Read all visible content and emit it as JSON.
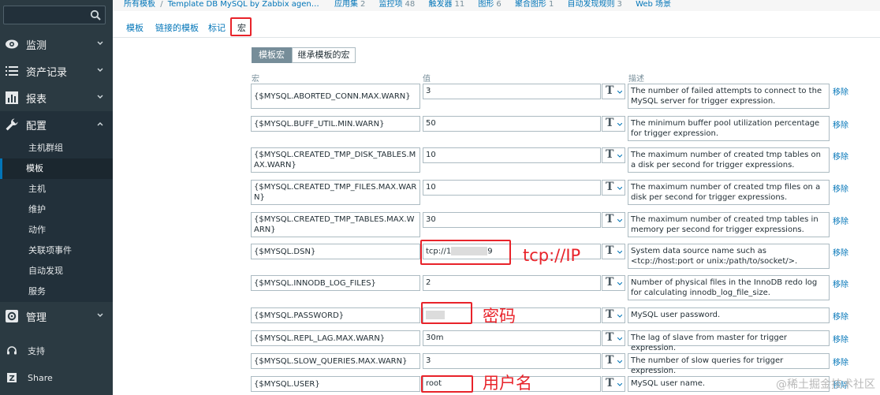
{
  "sidebar": {
    "sections": [
      {
        "label": "监测",
        "icon": "eye-icon"
      },
      {
        "label": "资产记录",
        "icon": "list-icon"
      },
      {
        "label": "报表",
        "icon": "bar-chart-icon"
      },
      {
        "label": "配置",
        "icon": "wrench-icon"
      },
      {
        "label": "管理",
        "icon": "gear-icon"
      }
    ],
    "config_items": [
      "主机群组",
      "模板",
      "主机",
      "维护",
      "动作",
      "关联项事件",
      "自动发现",
      "服务"
    ],
    "bottom": [
      {
        "label": "支持",
        "icon": "headset-icon"
      },
      {
        "label": "Share",
        "icon": "share-icon"
      }
    ]
  },
  "header": {
    "crumb_root": "所有模板",
    "crumb_template": "Template DB MySQL by Zabbix agen…",
    "links": [
      {
        "label": "应用集",
        "count": "2"
      },
      {
        "label": "监控项",
        "count": "48"
      },
      {
        "label": "触发器",
        "count": "11"
      },
      {
        "label": "图形",
        "count": "6"
      },
      {
        "label": "聚合图形",
        "count": "1"
      },
      {
        "label": "自动发现规则",
        "count": "3"
      },
      {
        "label": "Web 场景",
        "count": ""
      }
    ]
  },
  "tabs": [
    "模板",
    "链接的模板",
    "标记",
    "宏"
  ],
  "segment": {
    "template_macros": "模板宏",
    "inherited_macros": "继承模板的宏"
  },
  "columns": {
    "macro": "宏",
    "value": "值",
    "description": "描述"
  },
  "remove_label": "移除",
  "macros": [
    {
      "macro": "{$MYSQL.ABORTED_CONN.MAX.WARN}",
      "value": "3",
      "description": "The number of failed attempts to connect to the MySQL server for trigger expression."
    },
    {
      "macro": "{$MYSQL.BUFF_UTIL.MIN.WARN}",
      "value": "50",
      "description": "The minimum buffer pool utilization percentage for trigger expression."
    },
    {
      "macro": "{$MYSQL.CREATED_TMP_DISK_TABLES.MAX.WARN}",
      "value": "10",
      "description": "The maximum number of created tmp tables on a disk per second for trigger expressions."
    },
    {
      "macro": "{$MYSQL.CREATED_TMP_FILES.MAX.WARN}",
      "value": "10",
      "description": "The maximum number of created tmp files on a disk per second for trigger expressions."
    },
    {
      "macro": "{$MYSQL.CREATED_TMP_TABLES.MAX.WARN}",
      "value": "30",
      "description": "The maximum number of created tmp tables in memory per second for trigger expressions."
    },
    {
      "macro": "{$MYSQL.DSN}",
      "value_prefix": "tcp://1",
      "value_suffix": "9",
      "description": "System data source name such as <tcp://host:port or unix:/path/to/socket/>."
    },
    {
      "macro": "{$MYSQL.INNODB_LOG_FILES}",
      "value": "2",
      "description": "Number of physical files in the InnoDB redo log for calculating innodb_log_file_size."
    },
    {
      "macro": "{$MYSQL.PASSWORD}",
      "value": "",
      "description": "MySQL user password."
    },
    {
      "macro": "{$MYSQL.REPL_LAG.MAX.WARN}",
      "value": "30m",
      "description": "The lag of slave from master for trigger expression."
    },
    {
      "macro": "{$MYSQL.SLOW_QUERIES.MAX.WARN}",
      "value": "3",
      "description": "The number of slow queries for trigger expression."
    },
    {
      "macro": "{$MYSQL.USER}",
      "value": "root",
      "description": "MySQL user name."
    }
  ],
  "type_glyph": "T",
  "annotations": {
    "ip": "tcp://IP",
    "password": "密码",
    "username": "用户名"
  },
  "watermark": "@稀土掘金技术社区"
}
